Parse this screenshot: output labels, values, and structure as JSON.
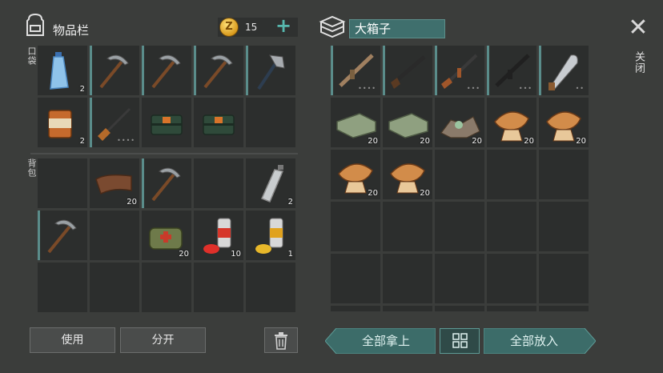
{
  "inventory": {
    "title": "物品栏",
    "coins": {
      "icon_letter": "Z",
      "amount": "15",
      "add_label": "+"
    },
    "pockets_label": "口袋",
    "backpack_label": "背包",
    "pockets": [
      {
        "item": "water-bottle-icon",
        "qty": "2",
        "bar": false,
        "dots": ""
      },
      {
        "item": "pickaxe-icon",
        "qty": "",
        "bar": true,
        "dots": ""
      },
      {
        "item": "pickaxe-icon",
        "qty": "",
        "bar": true,
        "dots": ""
      },
      {
        "item": "pickaxe-icon",
        "qty": "",
        "bar": true,
        "dots": ""
      },
      {
        "item": "hatchet-icon",
        "qty": "",
        "bar": true,
        "dots": ""
      },
      {
        "item": "canned-food-icon",
        "qty": "2",
        "bar": false,
        "dots": ""
      },
      {
        "item": "rifle-icon",
        "qty": "",
        "bar": true,
        "dots": "••••"
      },
      {
        "item": "supply-crate-icon",
        "qty": "",
        "bar": false,
        "dots": ""
      },
      {
        "item": "supply-crate-icon",
        "qty": "",
        "bar": false,
        "dots": ""
      },
      {
        "item": "",
        "qty": "",
        "bar": false,
        "dots": ""
      }
    ],
    "backpack": [
      {
        "item": "",
        "qty": "",
        "bar": false,
        "dots": ""
      },
      {
        "item": "leather-icon",
        "qty": "20",
        "bar": false,
        "dots": ""
      },
      {
        "item": "pickaxe-icon",
        "qty": "",
        "bar": true,
        "dots": ""
      },
      {
        "item": "",
        "qty": "",
        "bar": false,
        "dots": ""
      },
      {
        "item": "empty-bottle-icon",
        "qty": "2",
        "bar": false,
        "dots": ""
      },
      {
        "item": "pickaxe-icon",
        "qty": "",
        "bar": true,
        "dots": ""
      },
      {
        "item": "",
        "qty": "",
        "bar": false,
        "dots": ""
      },
      {
        "item": "first-aid-bag-icon",
        "qty": "20",
        "bar": false,
        "dots": ""
      },
      {
        "item": "red-spray-can-icon",
        "qty": "10",
        "bar": false,
        "dots": ""
      },
      {
        "item": "yellow-spray-can-icon",
        "qty": "1",
        "bar": false,
        "dots": ""
      },
      {
        "item": "",
        "qty": "",
        "bar": false,
        "dots": ""
      },
      {
        "item": "",
        "qty": "",
        "bar": false,
        "dots": ""
      },
      {
        "item": "",
        "qty": "",
        "bar": false,
        "dots": ""
      },
      {
        "item": "",
        "qty": "",
        "bar": false,
        "dots": ""
      },
      {
        "item": "",
        "qty": "",
        "bar": false,
        "dots": ""
      }
    ],
    "use_label": "使用",
    "split_label": "分开",
    "trash_icon": "trash-icon"
  },
  "chest": {
    "title": "大箱子",
    "slots": [
      {
        "item": "assault-rifle-icon",
        "qty": "",
        "bar": true,
        "dots": "••••"
      },
      {
        "item": "shotgun-icon",
        "qty": "",
        "bar": true,
        "dots": ""
      },
      {
        "item": "ak-rifle-icon",
        "qty": "",
        "bar": true,
        "dots": "•••"
      },
      {
        "item": "m16-rifle-icon",
        "qty": "",
        "bar": true,
        "dots": "•••"
      },
      {
        "item": "machete-icon",
        "qty": "",
        "bar": true,
        "dots": "••"
      },
      {
        "item": "cloth-icon",
        "qty": "20",
        "bar": false,
        "dots": ""
      },
      {
        "item": "cloth-icon",
        "qty": "20",
        "bar": false,
        "dots": ""
      },
      {
        "item": "scrap-pile-icon",
        "qty": "20",
        "bar": false,
        "dots": ""
      },
      {
        "item": "mushroom-icon",
        "qty": "20",
        "bar": false,
        "dots": ""
      },
      {
        "item": "mushroom-icon",
        "qty": "20",
        "bar": false,
        "dots": ""
      },
      {
        "item": "mushroom-icon",
        "qty": "20",
        "bar": false,
        "dots": ""
      },
      {
        "item": "mushroom-icon",
        "qty": "20",
        "bar": false,
        "dots": ""
      },
      {
        "item": "",
        "qty": "",
        "bar": false,
        "dots": ""
      },
      {
        "item": "",
        "qty": "",
        "bar": false,
        "dots": ""
      },
      {
        "item": "",
        "qty": "",
        "bar": false,
        "dots": ""
      },
      {
        "item": "",
        "qty": "",
        "bar": false,
        "dots": ""
      },
      {
        "item": "",
        "qty": "",
        "bar": false,
        "dots": ""
      },
      {
        "item": "",
        "qty": "",
        "bar": false,
        "dots": ""
      },
      {
        "item": "",
        "qty": "",
        "bar": false,
        "dots": ""
      },
      {
        "item": "",
        "qty": "",
        "bar": false,
        "dots": ""
      },
      {
        "item": "",
        "qty": "",
        "bar": false,
        "dots": ""
      },
      {
        "item": "",
        "qty": "",
        "bar": false,
        "dots": ""
      },
      {
        "item": "",
        "qty": "",
        "bar": false,
        "dots": ""
      },
      {
        "item": "",
        "qty": "",
        "bar": false,
        "dots": ""
      },
      {
        "item": "",
        "qty": "",
        "bar": false,
        "dots": ""
      },
      {
        "item": "",
        "qty": "",
        "bar": false,
        "dots": ""
      },
      {
        "item": "",
        "qty": "",
        "bar": false,
        "dots": ""
      },
      {
        "item": "",
        "qty": "",
        "bar": false,
        "dots": ""
      },
      {
        "item": "",
        "qty": "",
        "bar": false,
        "dots": ""
      },
      {
        "item": "",
        "qty": "",
        "bar": false,
        "dots": ""
      }
    ],
    "take_all_label": "全部拿上",
    "put_all_label": "全部放入",
    "sort_icon": "grid-sort-icon"
  },
  "close": {
    "symbol": "✕",
    "label": "关闭"
  },
  "colors": {
    "teal": "#3c6c69",
    "slot": "#2c2e2d",
    "background": "#3b3d3b"
  }
}
